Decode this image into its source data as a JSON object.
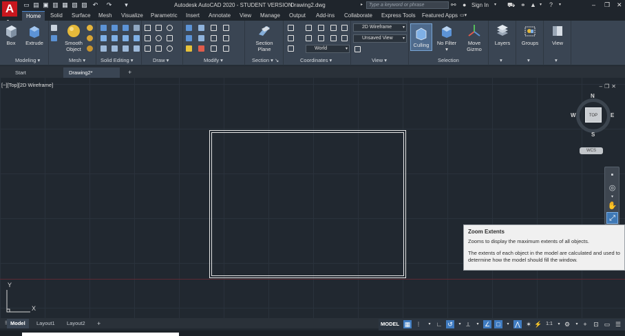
{
  "title_bar": {
    "app_letter": "A",
    "title": "Autodesk AutoCAD 2020 - STUDENT VERSION",
    "document": "Drawing2.dwg",
    "search_placeholder": "Type a keyword or phrase",
    "sign_in": "Sign In"
  },
  "ribbon_tabs": [
    "Home",
    "Solid",
    "Surface",
    "Mesh",
    "Visualize",
    "Parametric",
    "Insert",
    "Annotate",
    "View",
    "Manage",
    "Output",
    "Add-ins",
    "Collaborate",
    "Express Tools",
    "Featured Apps"
  ],
  "ribbon": {
    "panels": {
      "modeling": "Modeling",
      "mesh": "Mesh",
      "solid_editing": "Solid Editing",
      "draw": "Draw",
      "modify": "Modify",
      "section": "Section",
      "coordinates": "Coordinates",
      "view": "View",
      "selection": "Selection"
    },
    "buttons": {
      "box": "Box",
      "extrude": "Extrude",
      "smooth_object": [
        "Smooth",
        "Object"
      ],
      "section_plane": [
        "Section",
        "Plane"
      ],
      "culling": "Culling",
      "no_filter": "No Filter",
      "move_gizmo": [
        "Move",
        "Gizmo"
      ],
      "layers": "Layers",
      "groups": "Groups",
      "view": "View"
    },
    "combos": {
      "visual_style": "2D Wireframe",
      "named_view": "Unsaved View",
      "ucs": "World"
    }
  },
  "doc_tabs": [
    "Start",
    "Drawing2*"
  ],
  "viewport": {
    "label": "[−][Top][2D Wireframe]",
    "viewcube_top": "TOP",
    "compass": {
      "n": "N",
      "s": "S",
      "e": "E",
      "w": "W"
    },
    "wcs": "WCS",
    "ucs_x": "X",
    "ucs_y": "Y"
  },
  "tooltip": {
    "title": "Zoom Extents",
    "line1": "Zooms to display the maximum extents of all objects.",
    "line2": "The extents of each object in the model are calculated and used to determine how the model should fill the window."
  },
  "layout_tabs": [
    "Model",
    "Layout1",
    "Layout2"
  ],
  "status_bar": {
    "model": "MODEL",
    "scale": "1:1"
  },
  "colors": {
    "accent": "#3f7bc0",
    "app_red": "#c8171e",
    "canvas": "#212830",
    "ribbon": "#3a4553"
  }
}
